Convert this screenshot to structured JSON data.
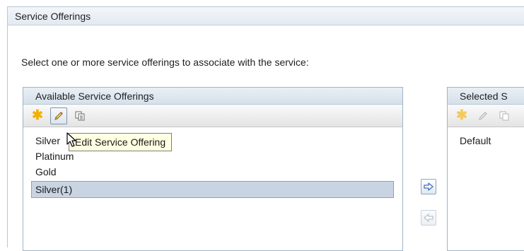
{
  "outer_panel": {
    "title": "Service Offerings"
  },
  "instruction": "Select one or more service offerings to associate with the service:",
  "available": {
    "header": "Available Service Offerings",
    "toolbar": [
      {
        "name": "new-icon",
        "glyph": "✱"
      },
      {
        "name": "edit-icon",
        "glyph": "pencil"
      },
      {
        "name": "copy-icon",
        "glyph": "copy"
      }
    ],
    "items": [
      "Silver",
      "Platinum",
      "Gold",
      "Silver(1)"
    ],
    "selected_item": "Silver(1)",
    "tooltip": "Edit Service Offering"
  },
  "selected": {
    "header": "Selected S",
    "items": [
      "Default"
    ]
  },
  "colors": {
    "accent": "#f2b100",
    "selection": "#c9d4e2",
    "arrow": "#3d6fb6"
  }
}
